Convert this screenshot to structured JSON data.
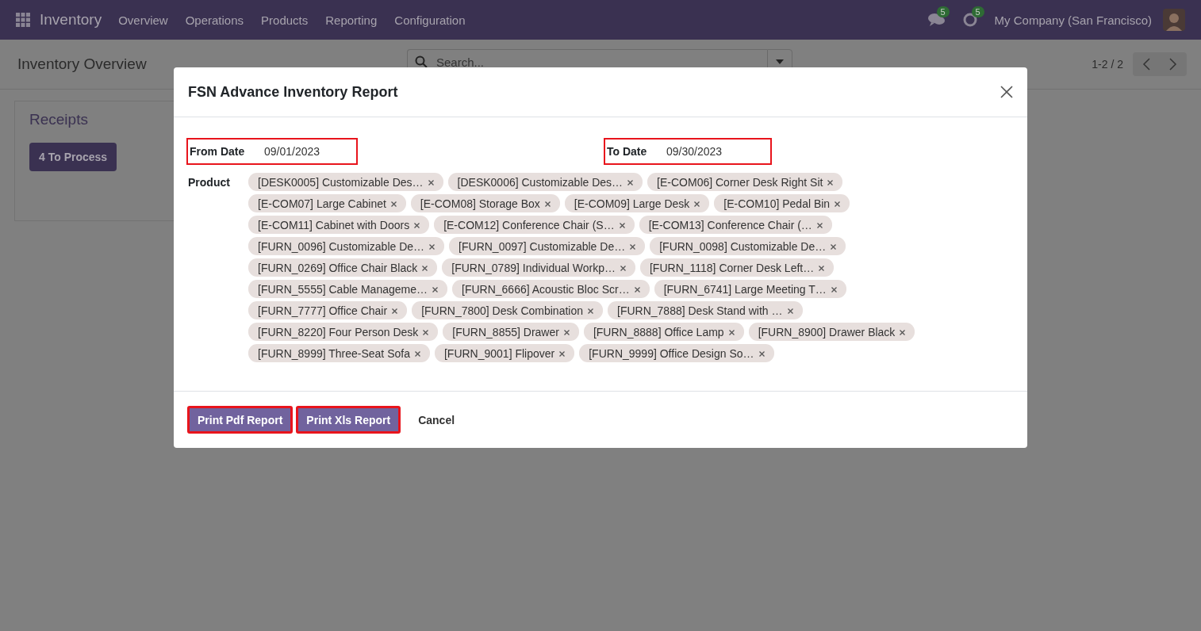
{
  "navbar": {
    "app": "Inventory",
    "menu": [
      "Overview",
      "Operations",
      "Products",
      "Reporting",
      "Configuration"
    ],
    "messages_badge": "5",
    "activities_badge": "5",
    "company": "My Company (San Francisco)"
  },
  "control_panel": {
    "title": "Inventory Overview",
    "search": {
      "placeholder": "Search..."
    },
    "pager": "1-2 / 2"
  },
  "card": {
    "title": "Receipts",
    "button": "4 To Process"
  },
  "dialog": {
    "title": "FSN Advance Inventory Report",
    "from_date": {
      "label": "From Date",
      "value": "09/01/2023",
      "highlighted": true
    },
    "to_date": {
      "label": "To Date",
      "value": "09/30/2023",
      "highlighted": true
    },
    "product": {
      "label": "Product",
      "rows": [
        [
          "[DESK0005] Customizable Des…",
          "[DESK0006] Customizable Des…",
          "[E-COM06] Corner Desk Right Sit"
        ],
        [
          "[E-COM07] Large Cabinet",
          "[E-COM08] Storage Box",
          "[E-COM09] Large Desk",
          "[E-COM10] Pedal Bin"
        ],
        [
          "[E-COM11] Cabinet with Doors",
          "[E-COM12] Conference Chair (S…",
          "[E-COM13] Conference Chair (…"
        ],
        [
          "[FURN_0096] Customizable De…",
          "[FURN_0097] Customizable De…",
          "[FURN_0098] Customizable De…"
        ],
        [
          "[FURN_0269] Office Chair Black",
          "[FURN_0789] Individual Workp…",
          "[FURN_1118] Corner Desk Left…"
        ],
        [
          "[FURN_5555] Cable Manageme…",
          "[FURN_6666] Acoustic Bloc Scr…",
          "[FURN_6741] Large Meeting T…"
        ],
        [
          "[FURN_7777] Office Chair",
          "[FURN_7800] Desk Combination",
          "[FURN_7888] Desk Stand with …"
        ],
        [
          "[FURN_8220] Four Person Desk",
          "[FURN_8855] Drawer",
          "[FURN_8888] Office Lamp",
          "[FURN_8900] Drawer Black"
        ],
        [
          "[FURN_8999] Three-Seat Sofa",
          "[FURN_9001] Flipover",
          "[FURN_9999] Office Design So…"
        ]
      ]
    },
    "buttons": [
      {
        "label": "Print Pdf Report",
        "kind": "primary",
        "highlighted": true
      },
      {
        "label": "Print Xls Report",
        "kind": "primary",
        "highlighted": true
      },
      {
        "label": "Cancel",
        "kind": "secondary",
        "highlighted": false
      }
    ]
  }
}
